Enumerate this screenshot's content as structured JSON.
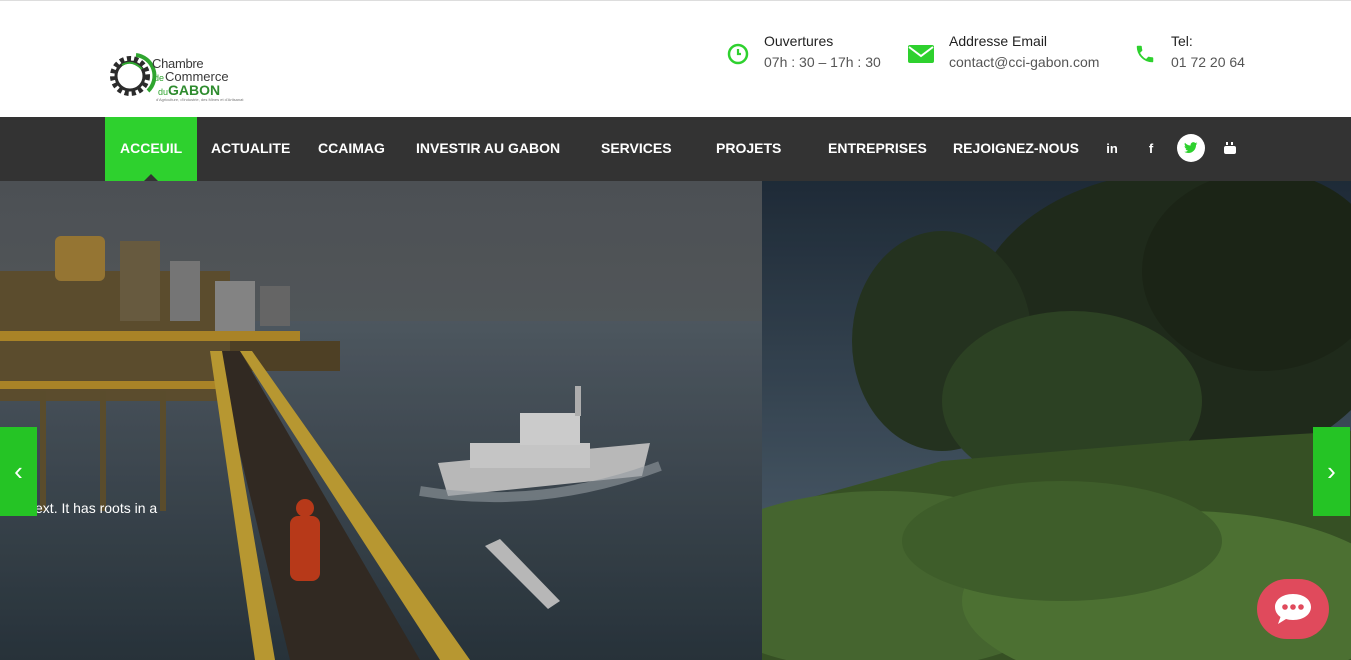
{
  "header": {
    "logo": {
      "line1": "Chambre",
      "de": "de",
      "line2": "Commerce",
      "du": "du",
      "line3": "GABON",
      "tagline": "d'Agriculture, d'Industrie, des Mines et d'Artisanat"
    },
    "hours": {
      "title": "Ouvertures",
      "value": "07h : 30 – 17h : 30",
      "icon": "clock-icon"
    },
    "email": {
      "title": "Addresse Email",
      "value": "contact@cci-gabon.com",
      "icon": "envelope-icon"
    },
    "phone": {
      "title": "Tel:",
      "value": "01 72 20 64",
      "icon": "phone-icon"
    }
  },
  "nav": {
    "items": [
      {
        "label": "ACCEUIL",
        "active": true
      },
      {
        "label": "ACTUALITE"
      },
      {
        "label": "CCAIMAG"
      },
      {
        "label": "INVESTIR AU GABON"
      },
      {
        "label": "SERVICES"
      },
      {
        "label": "PROJETS"
      },
      {
        "label": "ENTREPRISES"
      },
      {
        "label": "REJOIGNEZ-NOUS"
      }
    ],
    "social": [
      {
        "icon": "linkedin-icon",
        "glyph": "in"
      },
      {
        "icon": "facebook-icon",
        "glyph": "f"
      },
      {
        "icon": "twitter-icon",
        "glyph": "t"
      },
      {
        "icon": "youtube-icon",
        "glyph": "▶"
      }
    ]
  },
  "hero": {
    "caption": "dom text. It has roots in a",
    "prev_glyph": "‹",
    "next_glyph": "›"
  },
  "colors": {
    "accent": "#2ed12e",
    "nav_bg": "#333333",
    "chat": "#e04a5c"
  }
}
